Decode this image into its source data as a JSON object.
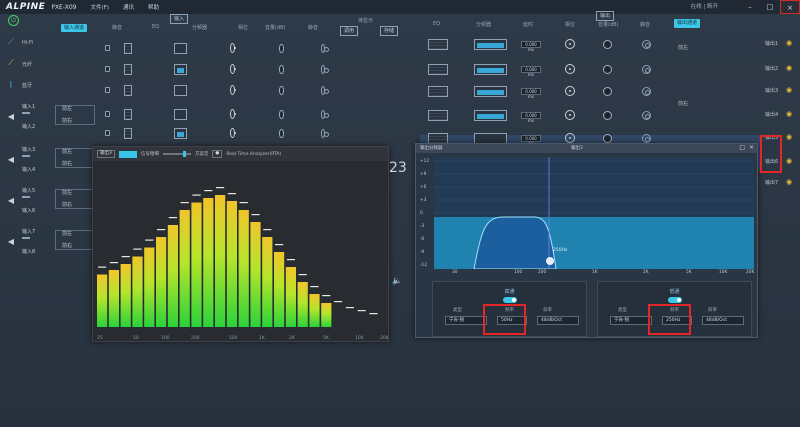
{
  "titlebar": {
    "logo": "ALPINE",
    "model": "PXE-X09",
    "menu": [
      "文件(F)",
      "通讯",
      "帮助"
    ],
    "right_text": "在线 | 断开",
    "window_controls": [
      "–",
      "□",
      "×"
    ]
  },
  "left_headers": {
    "input_tag": "输入",
    "first_btn": "输入通道",
    "mute": "静音",
    "peq": "EQ",
    "xover": "分频器",
    "phase": "相位",
    "gain": "音量(dB)",
    "mute2": "静音"
  },
  "mid_buttons": {
    "label": "待显示",
    "apply": "调用",
    "save": "存储"
  },
  "right_headers": {
    "output_tag": "输出",
    "eq": "EQ",
    "xover": "分频器",
    "delay": "延时",
    "phase": "相位",
    "gain": "音量(dB)",
    "mute": "静音",
    "out_btn": "输出通道"
  },
  "sources": [
    {
      "label": "Hi-Fi",
      "icon": "antenna-icon"
    },
    {
      "label": "光纤",
      "icon": "optical-icon"
    },
    {
      "label": "蓝牙",
      "icon": "bluetooth-icon"
    }
  ],
  "inputs": [
    {
      "a": "输入1",
      "b": "输入2",
      "sel1": "前左",
      "sel2": "前右"
    },
    {
      "a": "输入3",
      "b": "输入4",
      "sel1": "前左",
      "sel2": "前右"
    },
    {
      "a": "输入5",
      "b": "输入6",
      "sel1": "前左",
      "sel2": "前右"
    },
    {
      "a": "输入7",
      "b": "输入8",
      "sel1": "前左",
      "sel2": "前右"
    }
  ],
  "outputs": {
    "delay": "0.000 ms",
    "labels": [
      "输出1",
      "输出2",
      "输出3",
      "输出4",
      "输出5",
      "输出6",
      "输出7"
    ],
    "right_labels": [
      "前左",
      "前右",
      "中低音"
    ]
  },
  "rta": {
    "mode": "输出3",
    "noise_label": "信号粗细",
    "direction": "方案音",
    "dd2": "●",
    "name": "Real Time Analyzer(RTA)",
    "x_ticks": [
      "25",
      "50",
      "100",
      "200",
      "500",
      "1K",
      "2K",
      "5K",
      "10K",
      "20K"
    ],
    "levels": [
      0.35,
      0.38,
      0.42,
      0.47,
      0.53,
      0.6,
      0.68,
      0.78,
      0.83,
      0.86,
      0.88,
      0.84,
      0.78,
      0.7,
      0.6,
      0.5,
      0.4,
      0.3,
      0.22,
      0.16,
      0.12,
      0.08,
      0.06,
      0.04
    ]
  },
  "xover": {
    "title": "输出分频器",
    "channel": "输出3",
    "y_ticks": [
      "+12",
      "+9",
      "+6",
      "+3",
      "0",
      "-3",
      "-6",
      "-9",
      "-12"
    ],
    "x_ticks": [
      "30",
      "100",
      "200",
      "1K",
      "2K",
      "5K",
      "10K",
      "20K"
    ],
    "marker": "250Hz",
    "hp": {
      "title": "高通",
      "type_label": "类型",
      "type": "宁肯-锐",
      "freq_label": "频率",
      "freq": "50Hz",
      "slope_label": "斜率",
      "slope": "48dB/Oct"
    },
    "lp": {
      "title": "低通",
      "type_label": "类型",
      "type": "宁肯-锐",
      "freq_label": "频率",
      "freq": "250Hz",
      "slope_label": "斜率",
      "slope": "48dB/Oct"
    }
  },
  "colors": {
    "accent": "#3cc7e8",
    "highlight": "#e32626",
    "bg": "#2f3a48"
  }
}
